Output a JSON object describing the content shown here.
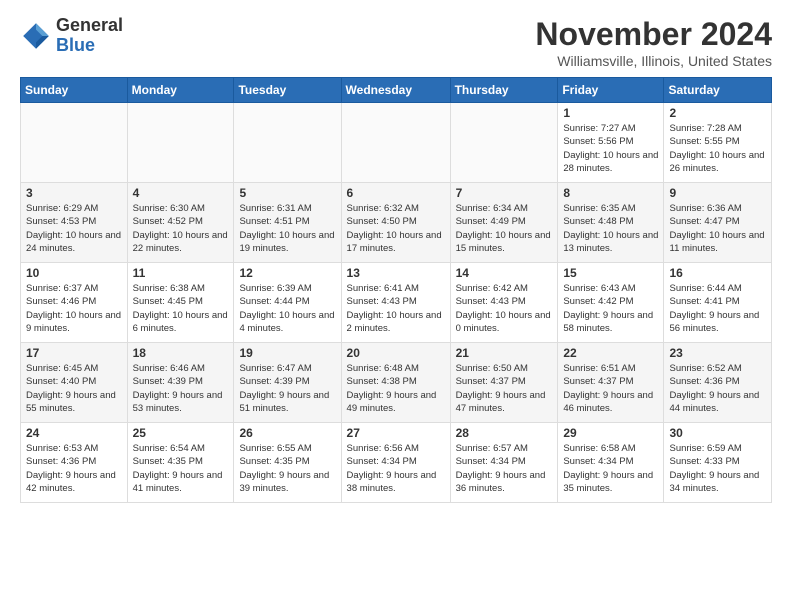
{
  "header": {
    "logo_general": "General",
    "logo_blue": "Blue",
    "month_title": "November 2024",
    "location": "Williamsville, Illinois, United States"
  },
  "days_of_week": [
    "Sunday",
    "Monday",
    "Tuesday",
    "Wednesday",
    "Thursday",
    "Friday",
    "Saturday"
  ],
  "weeks": [
    [
      {
        "day": "",
        "info": ""
      },
      {
        "day": "",
        "info": ""
      },
      {
        "day": "",
        "info": ""
      },
      {
        "day": "",
        "info": ""
      },
      {
        "day": "",
        "info": ""
      },
      {
        "day": "1",
        "info": "Sunrise: 7:27 AM\nSunset: 5:56 PM\nDaylight: 10 hours and 28 minutes."
      },
      {
        "day": "2",
        "info": "Sunrise: 7:28 AM\nSunset: 5:55 PM\nDaylight: 10 hours and 26 minutes."
      }
    ],
    [
      {
        "day": "3",
        "info": "Sunrise: 6:29 AM\nSunset: 4:53 PM\nDaylight: 10 hours and 24 minutes."
      },
      {
        "day": "4",
        "info": "Sunrise: 6:30 AM\nSunset: 4:52 PM\nDaylight: 10 hours and 22 minutes."
      },
      {
        "day": "5",
        "info": "Sunrise: 6:31 AM\nSunset: 4:51 PM\nDaylight: 10 hours and 19 minutes."
      },
      {
        "day": "6",
        "info": "Sunrise: 6:32 AM\nSunset: 4:50 PM\nDaylight: 10 hours and 17 minutes."
      },
      {
        "day": "7",
        "info": "Sunrise: 6:34 AM\nSunset: 4:49 PM\nDaylight: 10 hours and 15 minutes."
      },
      {
        "day": "8",
        "info": "Sunrise: 6:35 AM\nSunset: 4:48 PM\nDaylight: 10 hours and 13 minutes."
      },
      {
        "day": "9",
        "info": "Sunrise: 6:36 AM\nSunset: 4:47 PM\nDaylight: 10 hours and 11 minutes."
      }
    ],
    [
      {
        "day": "10",
        "info": "Sunrise: 6:37 AM\nSunset: 4:46 PM\nDaylight: 10 hours and 9 minutes."
      },
      {
        "day": "11",
        "info": "Sunrise: 6:38 AM\nSunset: 4:45 PM\nDaylight: 10 hours and 6 minutes."
      },
      {
        "day": "12",
        "info": "Sunrise: 6:39 AM\nSunset: 4:44 PM\nDaylight: 10 hours and 4 minutes."
      },
      {
        "day": "13",
        "info": "Sunrise: 6:41 AM\nSunset: 4:43 PM\nDaylight: 10 hours and 2 minutes."
      },
      {
        "day": "14",
        "info": "Sunrise: 6:42 AM\nSunset: 4:43 PM\nDaylight: 10 hours and 0 minutes."
      },
      {
        "day": "15",
        "info": "Sunrise: 6:43 AM\nSunset: 4:42 PM\nDaylight: 9 hours and 58 minutes."
      },
      {
        "day": "16",
        "info": "Sunrise: 6:44 AM\nSunset: 4:41 PM\nDaylight: 9 hours and 56 minutes."
      }
    ],
    [
      {
        "day": "17",
        "info": "Sunrise: 6:45 AM\nSunset: 4:40 PM\nDaylight: 9 hours and 55 minutes."
      },
      {
        "day": "18",
        "info": "Sunrise: 6:46 AM\nSunset: 4:39 PM\nDaylight: 9 hours and 53 minutes."
      },
      {
        "day": "19",
        "info": "Sunrise: 6:47 AM\nSunset: 4:39 PM\nDaylight: 9 hours and 51 minutes."
      },
      {
        "day": "20",
        "info": "Sunrise: 6:48 AM\nSunset: 4:38 PM\nDaylight: 9 hours and 49 minutes."
      },
      {
        "day": "21",
        "info": "Sunrise: 6:50 AM\nSunset: 4:37 PM\nDaylight: 9 hours and 47 minutes."
      },
      {
        "day": "22",
        "info": "Sunrise: 6:51 AM\nSunset: 4:37 PM\nDaylight: 9 hours and 46 minutes."
      },
      {
        "day": "23",
        "info": "Sunrise: 6:52 AM\nSunset: 4:36 PM\nDaylight: 9 hours and 44 minutes."
      }
    ],
    [
      {
        "day": "24",
        "info": "Sunrise: 6:53 AM\nSunset: 4:36 PM\nDaylight: 9 hours and 42 minutes."
      },
      {
        "day": "25",
        "info": "Sunrise: 6:54 AM\nSunset: 4:35 PM\nDaylight: 9 hours and 41 minutes."
      },
      {
        "day": "26",
        "info": "Sunrise: 6:55 AM\nSunset: 4:35 PM\nDaylight: 9 hours and 39 minutes."
      },
      {
        "day": "27",
        "info": "Sunrise: 6:56 AM\nSunset: 4:34 PM\nDaylight: 9 hours and 38 minutes."
      },
      {
        "day": "28",
        "info": "Sunrise: 6:57 AM\nSunset: 4:34 PM\nDaylight: 9 hours and 36 minutes."
      },
      {
        "day": "29",
        "info": "Sunrise: 6:58 AM\nSunset: 4:34 PM\nDaylight: 9 hours and 35 minutes."
      },
      {
        "day": "30",
        "info": "Sunrise: 6:59 AM\nSunset: 4:33 PM\nDaylight: 9 hours and 34 minutes."
      }
    ]
  ]
}
